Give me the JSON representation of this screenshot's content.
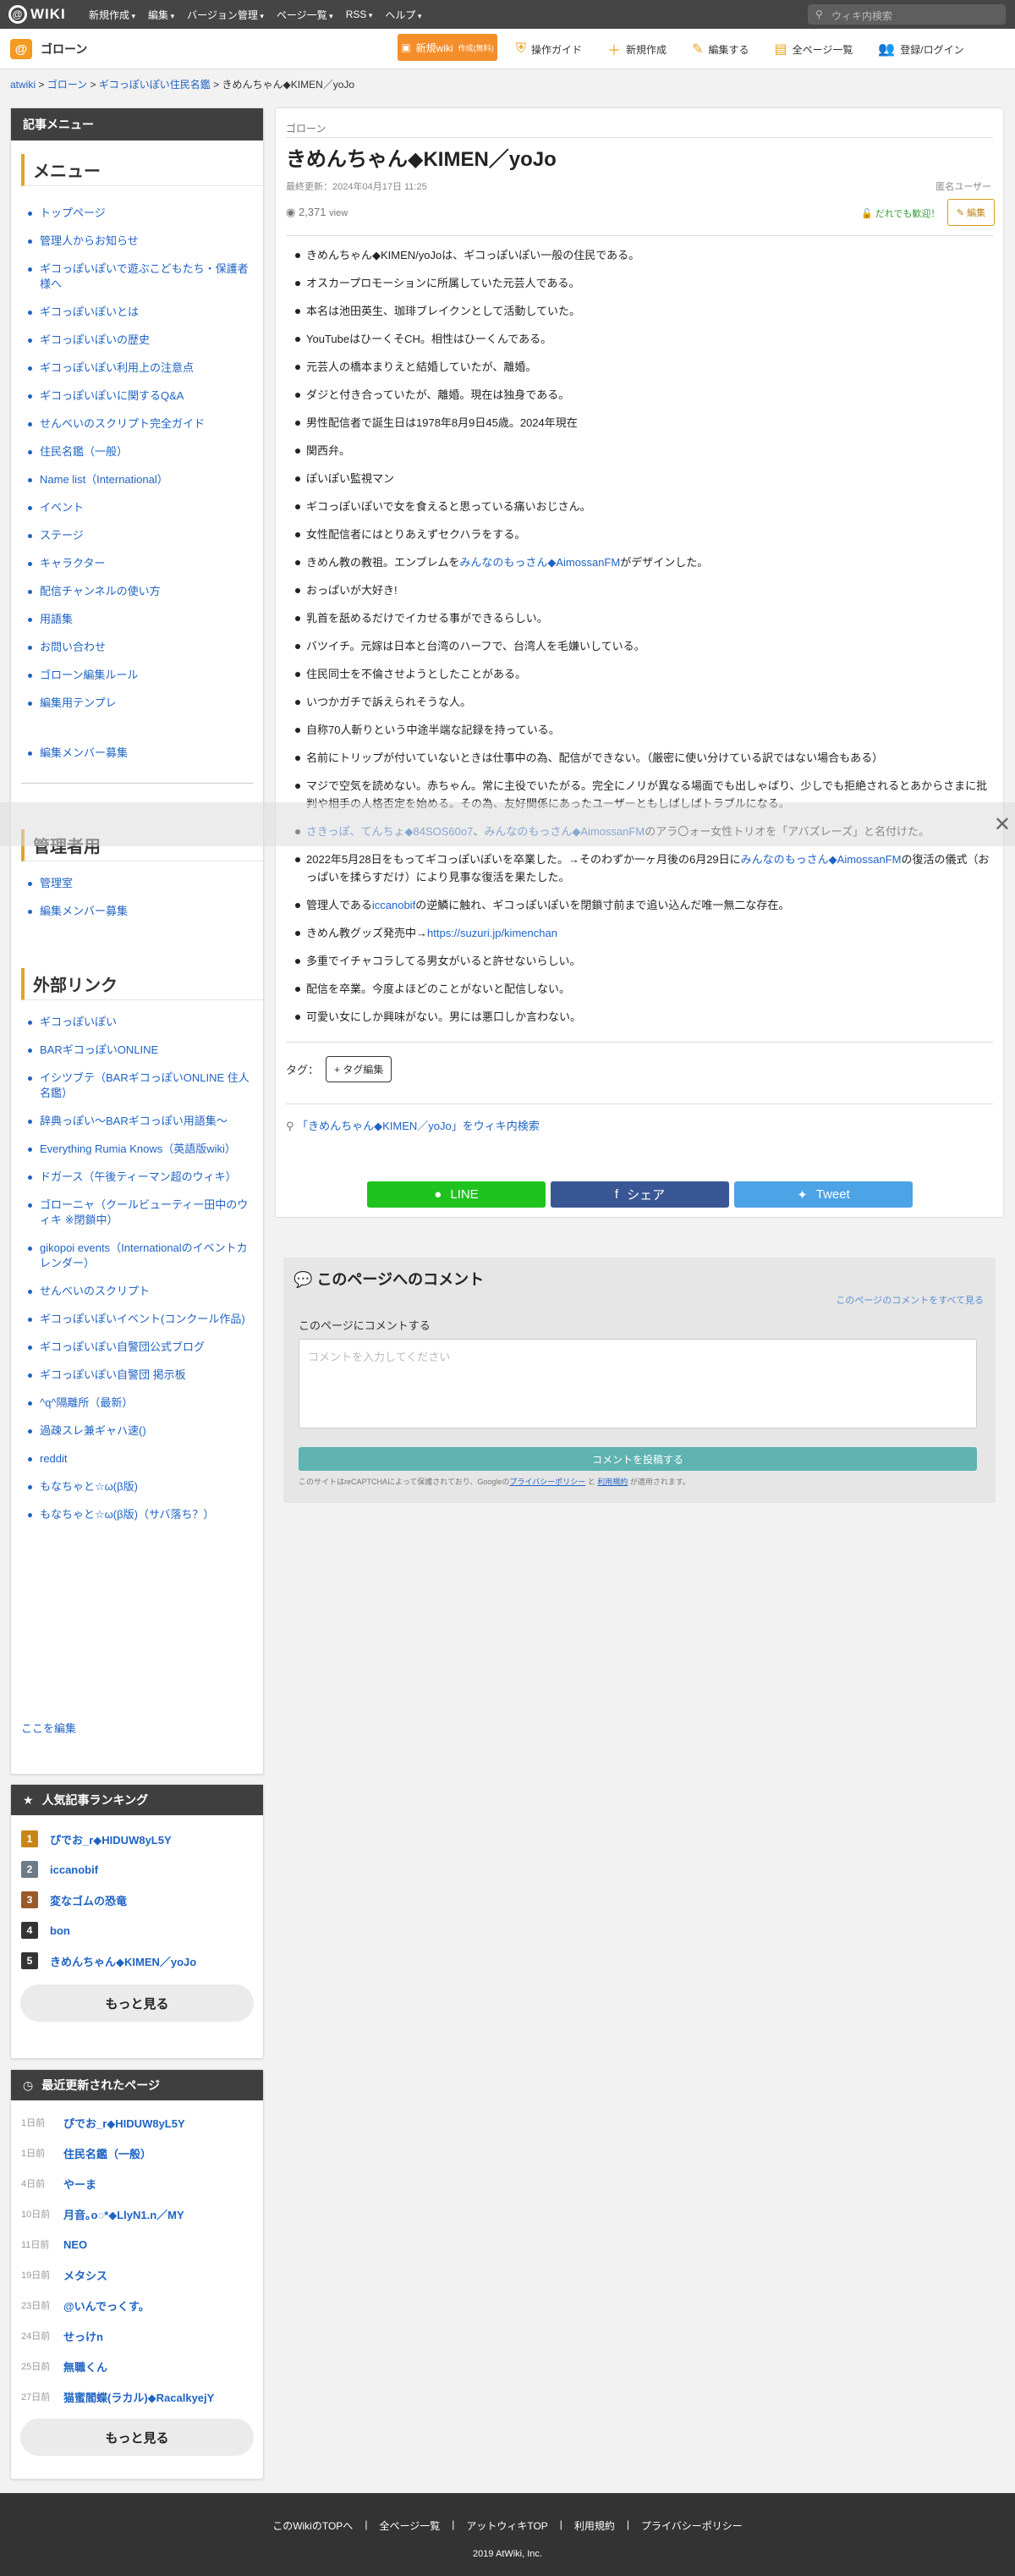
{
  "topbar": {
    "logo": "WIKI",
    "menu": [
      "新規作成",
      "編集",
      "バージョン管理",
      "ページ一覧",
      "RSS",
      "ヘルプ"
    ],
    "search_placeholder": "ウィキ内検索"
  },
  "subbar": {
    "wiki_name": "ゴローン",
    "new_wiki_label": "新規wiki",
    "new_wiki_sub": "作成(無料)",
    "actions": [
      "操作ガイド",
      "新規作成",
      "編集する",
      "全ページ一覧",
      "登録/ログイン"
    ]
  },
  "breadcrumb": [
    "atwiki",
    "ゴローン",
    "ギコっぽいぽい住民名鑑",
    "きめんちゃん◆KIMEN／yoJo"
  ],
  "sidebar": {
    "menu_title": "記事メニュー",
    "menu_head": "メニュー",
    "menu_items": [
      "トップページ",
      "管理人からお知らせ",
      "ギコっぽいぽいで遊ぶこどもたち・保護者様へ",
      "ギコっぽいぽいとは",
      "ギコっぽいぽいの歴史",
      "ギコっぽいぽい利用上の注意点",
      "ギコっぽいぽいに関するQ&A",
      "せんべいのスクリプト完全ガイド",
      "住民名鑑（一般）",
      "Name list（International）",
      "イベント",
      "ステージ",
      "キャラクター",
      "配信チャンネルの使い方",
      "用語集",
      "お問い合わせ",
      "ゴローン編集ルール",
      "編集用テンプレ"
    ],
    "recruit": "編集メンバー募集",
    "admin_head": "管理者用",
    "admin_items": [
      "管理室",
      "編集メンバー募集"
    ],
    "ext_head": "外部リンク",
    "ext_items": [
      "ギコっぽいぽい",
      "BARギコっぽいONLINE",
      "イシツブテ（BARギコっぽいONLINE 住人名鑑）",
      "辞典っぽい〜BARギコっぽい用語集〜",
      "Everything Rumia Knows（英語版wiki）",
      "ドガース（午後ティーマン超のウィキ）",
      "ゴローニャ（クールビューティー田中のウィキ ※閉鎖中）",
      "gikopoi events（Internationalのイベントカレンダー）",
      "せんべいのスクリプト",
      "ギコっぽいぽいイベント(コンクール作品)",
      "ギコっぽいぽい自警団公式ブログ",
      "ギコっぽいぽい自警団 掲示板",
      "^q^隔離所（最新）",
      "過疎スレ兼ギャハ速()",
      "reddit",
      "もなちゃと☆ω(β版)",
      "もなちゃと☆ω(β版)（サバ落ち？）"
    ],
    "edit_here": "ここを編集"
  },
  "ranking": {
    "title": "人気記事ランキング",
    "items": [
      {
        "rank": "1",
        "name": "ぴでお_r◆HIDUW8yL5Y",
        "color": "#c8861a"
      },
      {
        "rank": "2",
        "name": "iccanobif",
        "color": "#6d7a88"
      },
      {
        "rank": "3",
        "name": "変なゴムの恐竜",
        "color": "#9a5a2c"
      },
      {
        "rank": "4",
        "name": "bon",
        "color": "#333333"
      },
      {
        "rank": "5",
        "name": "きめんちゃん◆KIMEN／yoJo",
        "color": "#333333"
      }
    ],
    "more": "もっと見る"
  },
  "recent": {
    "title": "最近更新されたページ",
    "items": [
      {
        "ago": "1日前",
        "name": "ぴでお_r◆HIDUW8yL5Y"
      },
      {
        "ago": "1日前",
        "name": "住民名鑑（一般）"
      },
      {
        "ago": "4日前",
        "name": "やーま"
      },
      {
        "ago": "10日前",
        "name": "月音｡o◌*◆LlyN1.n／MY"
      },
      {
        "ago": "11日前",
        "name": "NEO"
      },
      {
        "ago": "19日前",
        "name": "メタシス"
      },
      {
        "ago": "23日前",
        "name": "@いんでっくす。"
      },
      {
        "ago": "24日前",
        "name": "せっけn"
      },
      {
        "ago": "25日前",
        "name": "無職くん"
      },
      {
        "ago": "27日前",
        "name": "猫蜜閻蝶(ラカル)◆RacalkyejY"
      }
    ],
    "more": "もっと見る"
  },
  "article": {
    "category": "ゴローン",
    "title": "きめんちゃん◆KIMEN／yoJo",
    "updated": "最終更新：2024年04月17日 11:25",
    "author": "匿名ユーザー",
    "views": "2,371",
    "views_unit": "view",
    "welcome": "だれでも歓迎！",
    "edit": "編集",
    "items": [
      "きめんちゃん◆KIMEN/yoJoは、ギコっぽいぽい一般の住民である。",
      "オスカープロモーションに所属していた元芸人である。",
      "本名は池田英生、珈琲ブレイクンとして活動していた。",
      "YouTubeはひーくそCH。相性はひーくんである。",
      "元芸人の橋本まりえと結婚していたが、離婚。",
      "ダジと付き合っていたが、離婚。現在は独身である。",
      "男性配信者で誕生日は1978年8月9日45歳。2024年現在",
      "関西弁。",
      "ぽいぽい監視マン",
      "ギコっぽいぽいで女を食えると思っている痛いおじさん。",
      "女性配信者にはとりあえずセクハラをする。",
      "きめん教の教祖。エンブレムを|みんなのもっさん◆AimossanFM|がデザインした。",
      "おっぱいが大好き!",
      "乳首を舐めるだけでイカせる事ができるらしい。",
      "バツイチ。元嫁は日本と台湾のハーフで、台湾人を毛嫌いしている。",
      "住民同士を不倫させようとしたことがある。",
      "いつかガチで訴えられそうな人。",
      "自称70人斬りという中途半端な記録を持っている。",
      "名前にトリップが付いていないときは仕事中の為、配信ができない。（厳密に使い分けている訳ではない場合もある）",
      "マジで空気を読めない。赤ちゃん。常に主役でいたがる。完全にノリが異なる場面でも出しゃばり、少しでも拒絶されるとあからさまに批判や相手の人格否定を始める。その為、友好関係にあったユーザーともしばしばトラブルになる。",
      "|さきっぽ、てんちょ◆84SOS60o7|、|みんなのもっさん◆AimossanFM|のアラ〇ォー女性トリオを「アバズレーズ」と名付けた。",
      "2022年5月28日をもってギコっぽいぽいを卒業した。→そのわずか一ヶ月後の6月29日に|みんなのもっさん◆AimossanFM|の復活の儀式（おっぱいを揉らすだけ）により見事な復活を果たした。",
      "管理人である|iccanobif|の逆鱗に触れ、ギコっぽいぽいを閉鎖寸前まで追い込んだ唯一無二な存在。",
      "きめん教グッズ発売中→|https://suzuri.jp/kimenchan|",
      "多重でイチャコラしてる男女がいると許せないらしい。",
      "配信を卒業。今度よほどのことがないと配信しない。",
      "可愛い女にしか興味がない。男には悪口しか言わない。"
    ],
    "tags_label": "タグ：",
    "tag_edit": "+ タグ編集",
    "wiki_search": "「きめんちゃん◆KIMEN／yoJo」をウィキ内検索"
  },
  "share": {
    "line": "LINE",
    "facebook": "シェア",
    "twitter": "Tweet",
    "line_color": "#1ec31e",
    "facebook_color": "#3a5795",
    "twitter_color": "#4ca3e6"
  },
  "comments": {
    "title": "このページへのコメント",
    "all_link": "このページのコメントをすべて見る",
    "prompt": "このページにコメントする",
    "placeholder": "コメントを入力してください",
    "submit": "コメントを投稿する",
    "recaptcha_pre": "このサイトはreCAPTCHAによって保護されており、Googleの",
    "privacy": "プライバシーポリシー",
    "and": "と",
    "terms": "利用規約",
    "recaptcha_post": "が適用されます。"
  },
  "footer": {
    "links": [
      "このWikiのTOPへ",
      "全ページ一覧",
      "アットウィキTOP",
      "利用規約",
      "プライバシーポリシー"
    ],
    "copyright": "2019 AtWiki, Inc."
  }
}
